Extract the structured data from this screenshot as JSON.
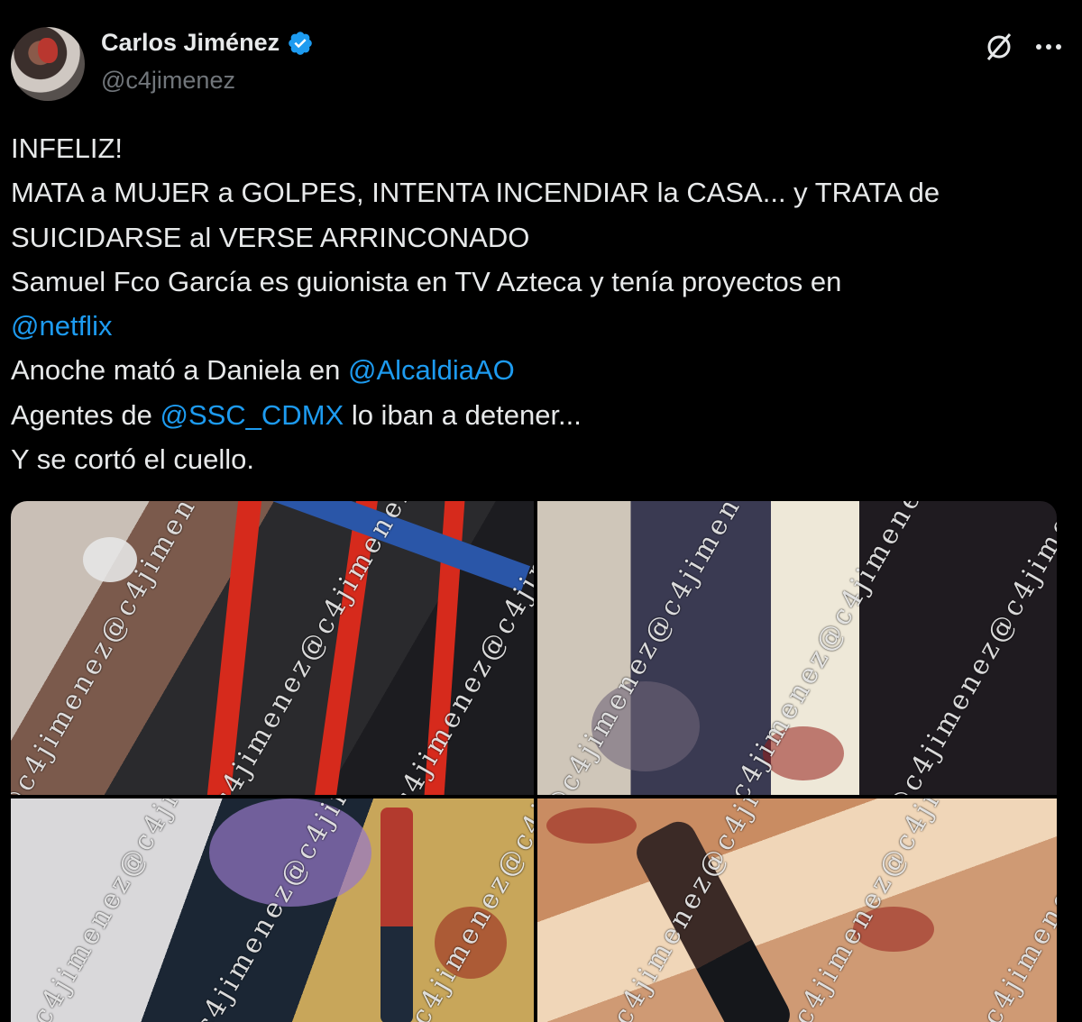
{
  "author": {
    "display_name": "Carlos Jiménez",
    "handle": "@c4jimenez",
    "verified": true
  },
  "icons": {
    "verified": "verified-badge-icon",
    "grok": "grok-icon",
    "more": "more-options-icon"
  },
  "colors": {
    "background": "#000000",
    "text": "#e7e9ea",
    "secondary": "#71767b",
    "link": "#1d9bf0",
    "verified": "#1d9bf0"
  },
  "tweet": {
    "line1": "INFELIZ!",
    "line2": "MATA a MUJER a GOLPES, INTENTA INCENDIAR la CASA... y TRATA de",
    "line3": "SUICIDARSE al VERSE ARRINCONADO",
    "line4": "Samuel Fco García es guionista en TV Azteca y tenía proyectos en",
    "mention_netflix": "@netflix",
    "line6_prefix": "Anoche mató a Daniela en ",
    "mention_alcaldia": "@AlcaldiaAO",
    "line7_prefix": "Agentes de ",
    "mention_ssc": "@SSC_CDMX",
    "line7_suffix": " lo iban a detener...",
    "line8": "Y se cortó el cuello."
  },
  "media": {
    "watermark": "@c4jimenez@c4jimenez@c4jimenez",
    "photos": [
      {
        "name": "photo-1"
      },
      {
        "name": "photo-2"
      },
      {
        "name": "photo-3"
      },
      {
        "name": "photo-4"
      }
    ]
  }
}
